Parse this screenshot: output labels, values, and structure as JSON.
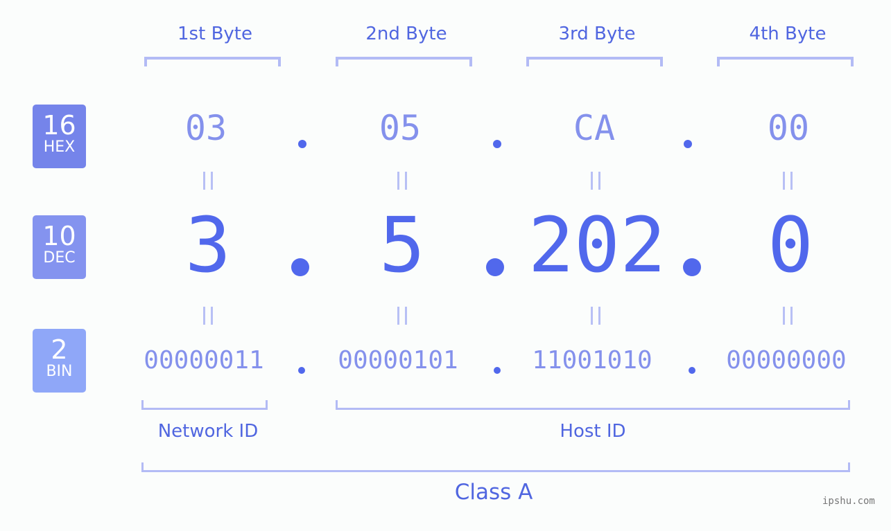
{
  "bytes": {
    "labels": [
      "1st Byte",
      "2nd Byte",
      "3rd Byte",
      "4th Byte"
    ]
  },
  "badges": {
    "hex": {
      "number": "16",
      "label": "HEX",
      "color": "#7584ea"
    },
    "dec": {
      "number": "10",
      "label": "DEC",
      "color": "#8493ef"
    },
    "bin": {
      "number": "2",
      "label": "BIN",
      "color": "#8fa7f8"
    }
  },
  "ip": {
    "hex": [
      "03",
      "05",
      "CA",
      "00"
    ],
    "dec": [
      "3",
      "5",
      "202",
      "0"
    ],
    "bin": [
      "00000011",
      "00000101",
      "11001010",
      "00000000"
    ]
  },
  "segments": {
    "network_id": "Network ID",
    "host_id": "Host ID",
    "class": "Class A"
  },
  "colors": {
    "accent": "#5168ec",
    "light_accent": "#8491ec",
    "bracket": "#b3bbf5",
    "background": "#fbfdfc"
  },
  "watermark": "ipshu.com"
}
